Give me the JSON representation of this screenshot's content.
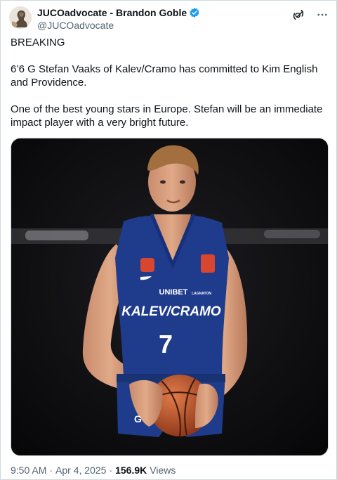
{
  "author": {
    "display_name": "JUCOadvocate - Brandon Goble",
    "handle": "@JUCOadvocate",
    "verified": true,
    "avatar_icon": "bust-statue-avatar-icon"
  },
  "post": {
    "paragraphs": [
      "BREAKING",
      "6’6 G Stefan Vaaks of Kalev/Cramo has committed to Kim English and Providence.",
      "One of the best young stars in Europe. Stefan will be an immediate impact player with a very bright future."
    ],
    "image": {
      "jersey_text": "KALEV/CRAMO",
      "jersey_number": "7",
      "sponsor_text": "UNIBET",
      "sponsor2_text": "LAGNATON"
    }
  },
  "meta": {
    "time": "9:50 AM",
    "separator": "·",
    "date": "Apr 4, 2025",
    "views_count": "156.9K",
    "views_label": "Views"
  },
  "icons": {
    "grok": "grok-icon",
    "more": "more-dots-icon",
    "verified": "verified-badge-icon"
  },
  "colors": {
    "text_primary": "#0f1419",
    "text_secondary": "#536471",
    "verified_blue": "#1d9bf0",
    "jersey_blue": "#1f3b8c",
    "border": "#cfd9de"
  }
}
